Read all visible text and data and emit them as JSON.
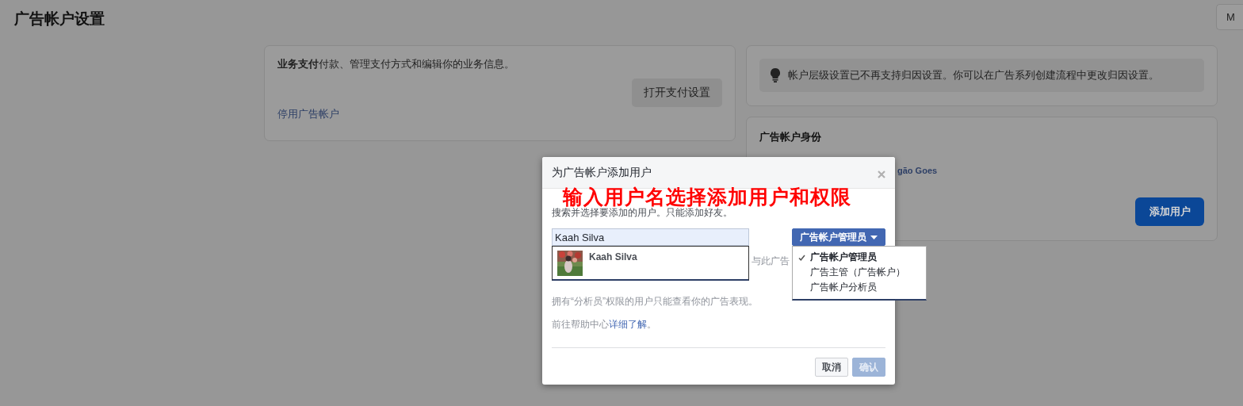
{
  "page": {
    "title": "广告帐户设置",
    "corner_button": "M"
  },
  "payment_card": {
    "lead": "**业务支付**付款、管理支付方式和编辑你的业务信息。",
    "button": "打开支付设置",
    "link": "停用广告帐户"
  },
  "notice_card": {
    "text": "帐户层级设置已不再支持归因设置。你可以在广告系列创建流程中更改归因设置。"
  },
  "identity_card": {
    "title": "广告帐户身份",
    "name_fragment": "gão Goes",
    "button": "添加用户"
  },
  "dialog": {
    "title": "为广告帐户添加用户",
    "annotation": "输入用户名选择添加用户和权限",
    "instruction": "搜索并选择要添加的用户。只能添加好友。",
    "search": {
      "value": "Kaah Silva"
    },
    "suggestions": [
      {
        "name": "Kaah Silva",
        "kind": "picture"
      }
    ],
    "role_button": "广告帐户管理员",
    "roles": [
      {
        "label": "广告帐户管理员",
        "selected": true
      },
      {
        "label": "广告主管（广告帐户）",
        "selected": false
      },
      {
        "label": "广告帐户分析员",
        "selected": false
      }
    ],
    "covered_fragment": "与此广告",
    "analyst_note": "拥有“分析员”权限的用户只能查看你的广告表现。",
    "help_prefix": "前往帮助中心",
    "help_link": "详细了解",
    "help_suffix": "。",
    "buttons": [
      {
        "label": "取消",
        "kind": "cancel",
        "disabled": false
      },
      {
        "label": "确认",
        "kind": "confirm",
        "disabled": true
      }
    ]
  }
}
